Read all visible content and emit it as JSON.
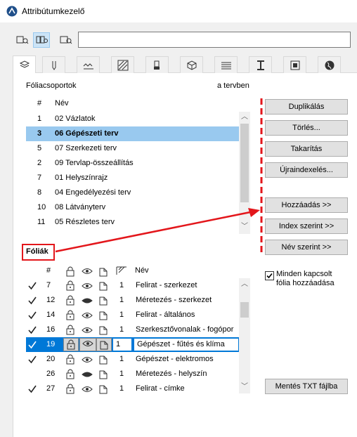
{
  "window": {
    "title": "Attribútumkezelő"
  },
  "colors": {
    "accent": "#0078d7",
    "selection_light": "#99c9ef",
    "annotation_red": "#e3161b"
  },
  "groups": {
    "label": "Fóliacsoportok",
    "col_in_project": "a tervben",
    "headers": {
      "num": "#",
      "name": "Név"
    },
    "rows": [
      {
        "num": "1",
        "name": "02 Vázlatok",
        "selected": false
      },
      {
        "num": "3",
        "name": "06 Gépészeti terv",
        "selected": true
      },
      {
        "num": "5",
        "name": "07 Szerkezeti terv",
        "selected": false
      },
      {
        "num": "2",
        "name": "09 Tervlap-összeállítás",
        "selected": false
      },
      {
        "num": "7",
        "name": "01 Helyszínrajz",
        "selected": false
      },
      {
        "num": "8",
        "name": "04 Engedélyezési terv",
        "selected": false
      },
      {
        "num": "10",
        "name": "08 Látványterv",
        "selected": false
      },
      {
        "num": "11",
        "name": "05 Részletes terv",
        "selected": false
      }
    ]
  },
  "buttons": {
    "duplicate": "Duplikálás",
    "delete": "Törlés...",
    "purge": "Takarítás",
    "reindex": "Újraindexelés...",
    "add": "Hozzáadás >>",
    "by_index": "Index szerint >>",
    "by_name": "Név szerint >>",
    "save_txt": "Mentés TXT fájlba"
  },
  "layers": {
    "label": "Fóliák",
    "headers": {
      "num": "#",
      "name": "Név"
    },
    "rows": [
      {
        "checked": true,
        "num": "7",
        "lock": "unlocked",
        "eye": "open",
        "intersect": "1",
        "name": "Felirat - szerkezet"
      },
      {
        "checked": true,
        "num": "12",
        "lock": "unlocked",
        "eye": "closed",
        "intersect": "1",
        "name": "Méretezés - szerkezet"
      },
      {
        "checked": true,
        "num": "14",
        "lock": "unlocked",
        "eye": "open",
        "intersect": "1",
        "name": "Felirat - általános"
      },
      {
        "checked": true,
        "num": "16",
        "lock": "unlocked",
        "eye": "open",
        "intersect": "1",
        "name": "Szerkesztővonalak - fogópor"
      },
      {
        "checked": true,
        "num": "19",
        "lock": "unlocked",
        "eye": "open",
        "intersect": "1",
        "name": "Gépészet - fűtés és klíma",
        "selected": true
      },
      {
        "checked": true,
        "num": "20",
        "lock": "unlocked",
        "eye": "open",
        "intersect": "1",
        "name": "Gépészet - elektromos"
      },
      {
        "checked": false,
        "num": "26",
        "lock": "unlocked",
        "eye": "closed",
        "intersect": "1",
        "name": "Méretezés - helyszín"
      },
      {
        "checked": true,
        "num": "27",
        "lock": "unlocked",
        "eye": "open",
        "intersect": "1",
        "name": "Felirat - címke"
      }
    ]
  },
  "options": {
    "add_connected": "Minden kapcsolt\nfólia hozzáadása",
    "add_connected_checked": true
  }
}
